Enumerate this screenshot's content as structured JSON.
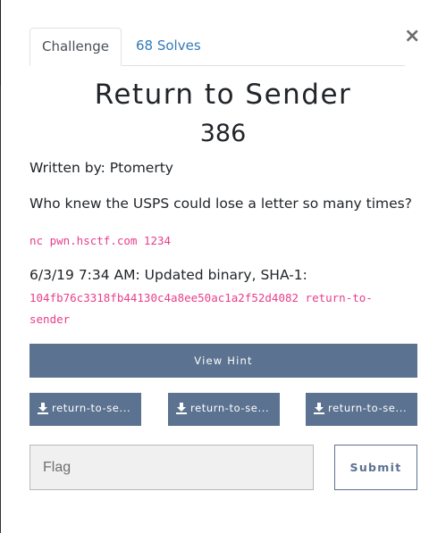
{
  "tabs": {
    "challenge_label": "Challenge",
    "solves_label": "68 Solves"
  },
  "close_icon": "×",
  "challenge": {
    "name": "Return to Sender",
    "points": "386",
    "author_line": "Written by: Ptomerty",
    "description": "Who knew the USPS could lose a letter so many times?",
    "connection": "nc pwn.hsctf.com 1234",
    "update_line": "6/3/19 7:34 AM: Updated binary, SHA-1:",
    "sha_line1": "104fb76c3318fb44130c4a8ee50ac1a2f52d4082 return-to-",
    "sha_line2": "sender"
  },
  "hint_button_label": "View Hint",
  "files": [
    {
      "label": "return-to-se...",
      "icon": "download-icon"
    },
    {
      "label": "return-to-se...",
      "icon": "download-icon"
    },
    {
      "label": "return-to-se...",
      "icon": "download-icon"
    }
  ],
  "flag": {
    "placeholder": "Flag",
    "value": ""
  },
  "submit_label": "Submit",
  "colors": {
    "accent": "#5b7290",
    "link": "#337ab7",
    "code": "#e83e8c"
  }
}
